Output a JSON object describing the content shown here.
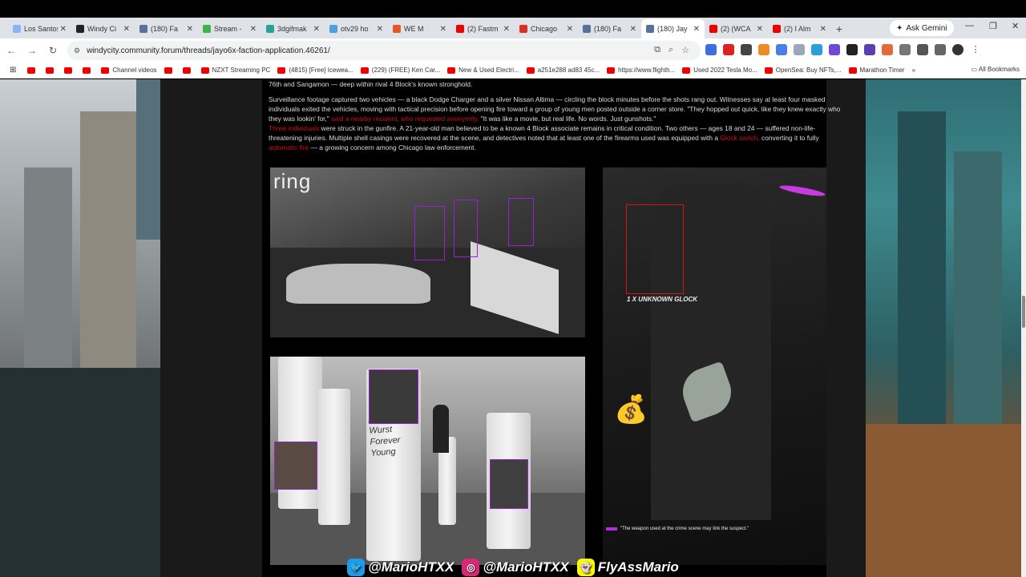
{
  "tabs": [
    {
      "title": "Los Santos",
      "color": "#8ab4f8"
    },
    {
      "title": "Windy Ci",
      "color": "#222"
    },
    {
      "title": "(180) Fa",
      "color": "#5a6f9c"
    },
    {
      "title": "Stream -",
      "color": "#3bb54a"
    },
    {
      "title": "3dgifmak",
      "color": "#2aa198"
    },
    {
      "title": "otv29 ho",
      "color": "#4aa3df"
    },
    {
      "title": "WE M",
      "color": "#e8552a"
    },
    {
      "title": "(2) Fastm",
      "color": "#e00"
    },
    {
      "title": "Chicago",
      "color": "#d93025"
    },
    {
      "title": "(180) Fa",
      "color": "#5a6f9c"
    },
    {
      "title": "(180) Jay",
      "color": "#5a6f9c",
      "active": true
    },
    {
      "title": "(2) (WCA",
      "color": "#e00"
    },
    {
      "title": "(2) I Alm",
      "color": "#e00"
    }
  ],
  "gemini_label": "Ask Gemini",
  "url": "windycity.community.forum/threads/jayo6x-faction-application.46261/",
  "bookmarks": [
    "",
    "",
    "",
    "",
    "Channel videos",
    "",
    "",
    "NZXT Streaming PC",
    "(4815) [Free] Icewea...",
    "(229) (FREE) Ken Car...",
    "New & Used Electri...",
    "a251e288 ad83 45c...",
    "https://www.flighth...",
    "Used 2022 Tesla Mo...",
    "OpenSea: Buy NFTs,...",
    "Marathon Timer"
  ],
  "all_bookmarks": "All Bookmarks",
  "article": {
    "line0": "76th and Sangamon — deep within rival 4 Block's known stronghold.",
    "p1a": "Surveillance footage captured two vehicles — a black Dodge Charger and a silver Nissan Altima — circling the block minutes before the shots rang out. Witnesses say at least four masked individuals exited the vehicles, moving with tactical precision before opening fire toward a group of young men posted outside a corner store. \"They hopped out quick, like they knew exactly who they was lookin' for,\"",
    "p1red": "said a nearby resident, who requested anonymity.",
    "p1b": "\"It was like a movie, but real life. No words. Just gunshots.\"",
    "p2red1": "Three individuals",
    "p2a": "were struck in the gunfire. A 21-year-old man believed to be a known 4 Block associate remains in critical condition. Two others — ages 18 and 24 — suffered non-life-threatening injuries. Multiple shell casings were recovered at the scene, and detectives noted that at least one of the firearms used was equipped with a",
    "p2red2": "Glock switch,",
    "p2b": "converting it to fully",
    "p2red3": "automatic fire",
    "p2c": "— a growing concern among Chicago law enforcement."
  },
  "images": {
    "ring_logo": "ring",
    "glock_caption": "1 X UNKNOWN GLOCK",
    "weapon_note": "\"The weapon used at the crime scene may link the suspect.\"",
    "candle_text": "Ashly Wurst Forever Young"
  },
  "social": [
    {
      "platform": "twitter-icon",
      "handle": "@MarioHTXX",
      "color": "#1d9bf0"
    },
    {
      "platform": "instagram-icon",
      "handle": "@MarioHTXX",
      "color": "#d62976"
    },
    {
      "platform": "snapchat-icon",
      "handle": "FlyAssMario",
      "color": "#fffc00"
    }
  ]
}
